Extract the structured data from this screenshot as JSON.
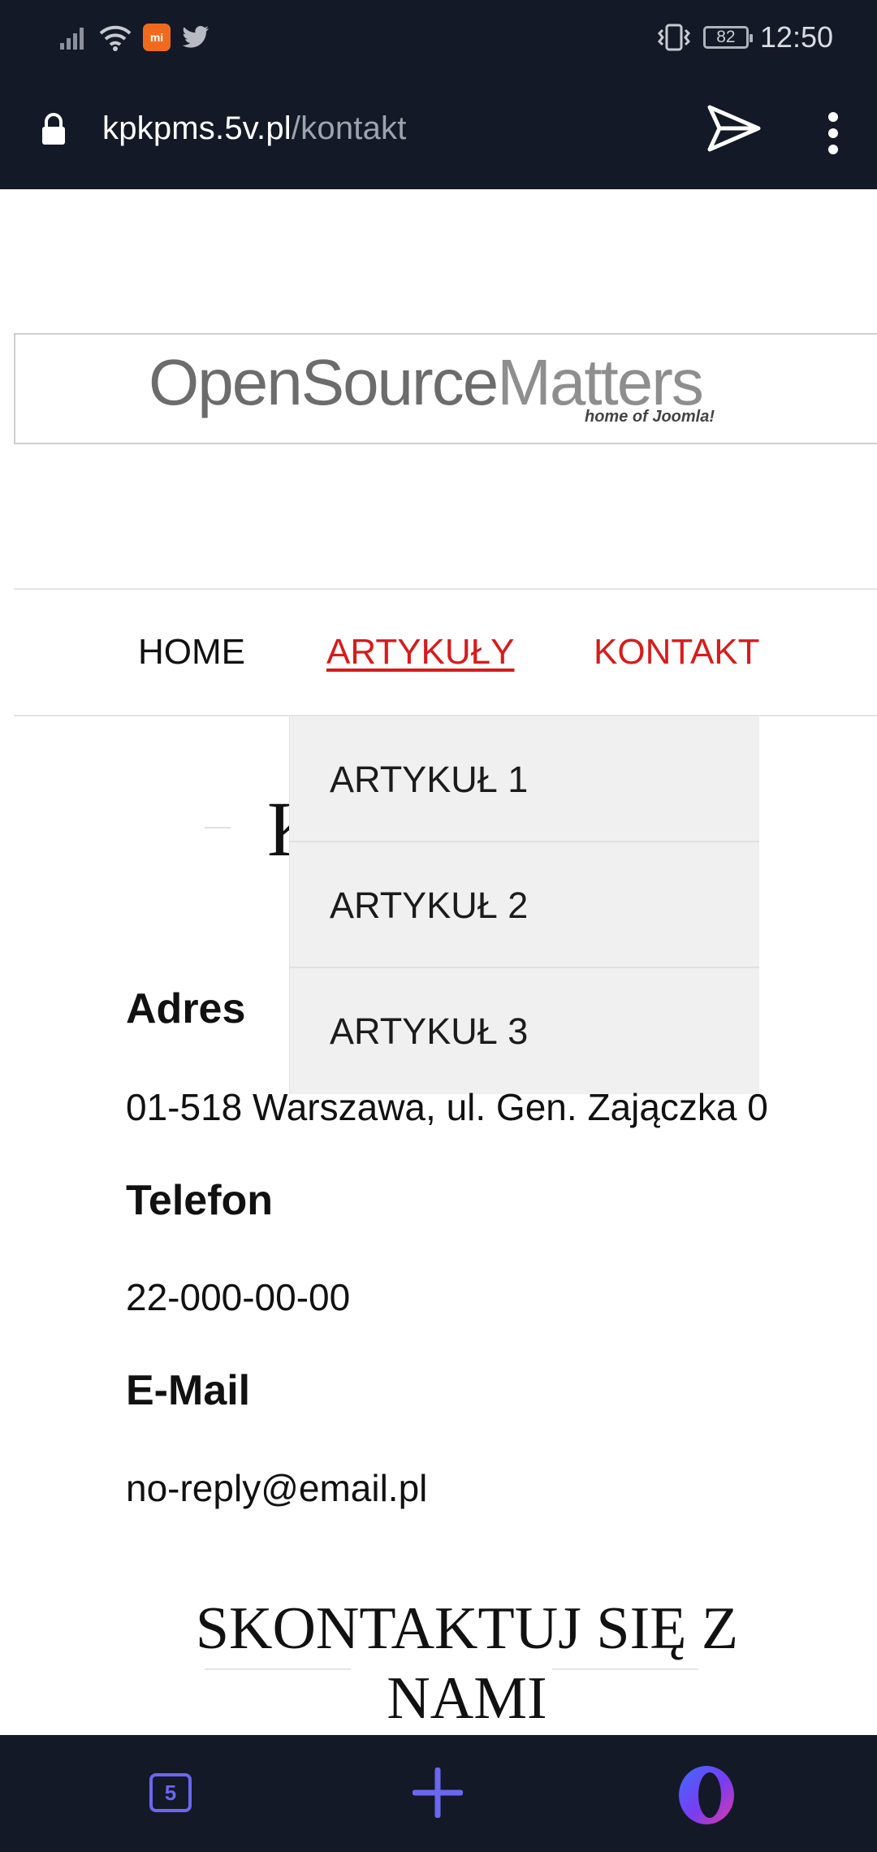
{
  "status_bar": {
    "time": "12:50",
    "battery": "82"
  },
  "address_bar": {
    "domain": "kpkpms.5v.pl",
    "path": "/kontakt"
  },
  "logo": {
    "main_dark": "OpenSource",
    "main_light": "Matters",
    "sub": "home of Joomla!"
  },
  "nav": {
    "items": [
      {
        "label": "HOME"
      },
      {
        "label": "ARTYKUŁY"
      },
      {
        "label": "KONTAKT"
      }
    ]
  },
  "dropdown": {
    "items": [
      {
        "label": "ARTYKUŁ 1"
      },
      {
        "label": "ARTYKUŁ 2"
      },
      {
        "label": "ARTYKUŁ 3"
      }
    ]
  },
  "page_heading_partial": "K",
  "contact": {
    "address_label": "Adres",
    "address_value": "01-518 Warszawa, ul. Gen. Zajączka 0",
    "phone_label": "Telefon",
    "phone_value": "22-000-00-00",
    "email_label": "E-Mail",
    "email_value": "no-reply@email.pl"
  },
  "cta": {
    "line1": "SKONTAKTUJ SIĘ Z",
    "line2": "NAMI"
  },
  "bottom_bar": {
    "tab_count": "5"
  },
  "colors": {
    "accent_red": "#d81b1b",
    "bar_bg": "#141927",
    "opera_purple": "#6b67f0"
  },
  "icons": [
    "signal-icon",
    "wifi-icon",
    "mi-app-icon",
    "twitter-icon",
    "vibrate-icon",
    "battery-icon",
    "lock-icon",
    "send-icon",
    "more-menu-icon",
    "tabs-icon",
    "plus-icon",
    "opera-icon"
  ]
}
